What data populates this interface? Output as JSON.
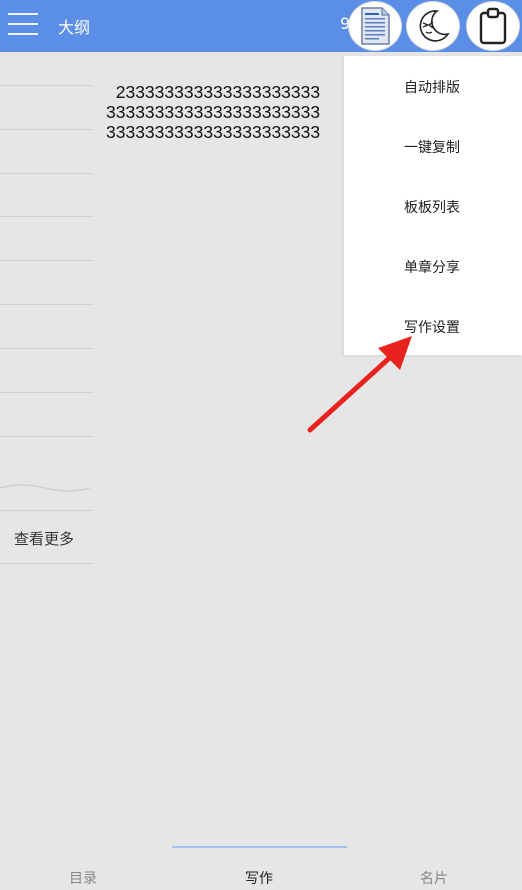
{
  "header": {
    "title": "大纲",
    "partial_text": "9"
  },
  "editor": {
    "lines": [
      "  233333333333333333333",
      "3333333333333333333333",
      "3333333333333333333333"
    ]
  },
  "sidebar": {
    "more_label": "查看更多"
  },
  "dropdown": {
    "items": [
      "自动排版",
      "一键复制",
      "板板列表",
      "单章分享",
      "写作设置"
    ]
  },
  "tabs": {
    "items": [
      "目录",
      "写作",
      "名片"
    ],
    "active": "写作"
  },
  "icons": {
    "menu": "hamburger-menu-icon",
    "doc": "document-icon",
    "moon": "moon-face-icon",
    "clipboard": "clipboard-icon",
    "arrow": "red-arrow"
  },
  "colors": {
    "header": "#5b8ee6",
    "arrow": "#e8231f",
    "background": "#e6e6e6"
  }
}
